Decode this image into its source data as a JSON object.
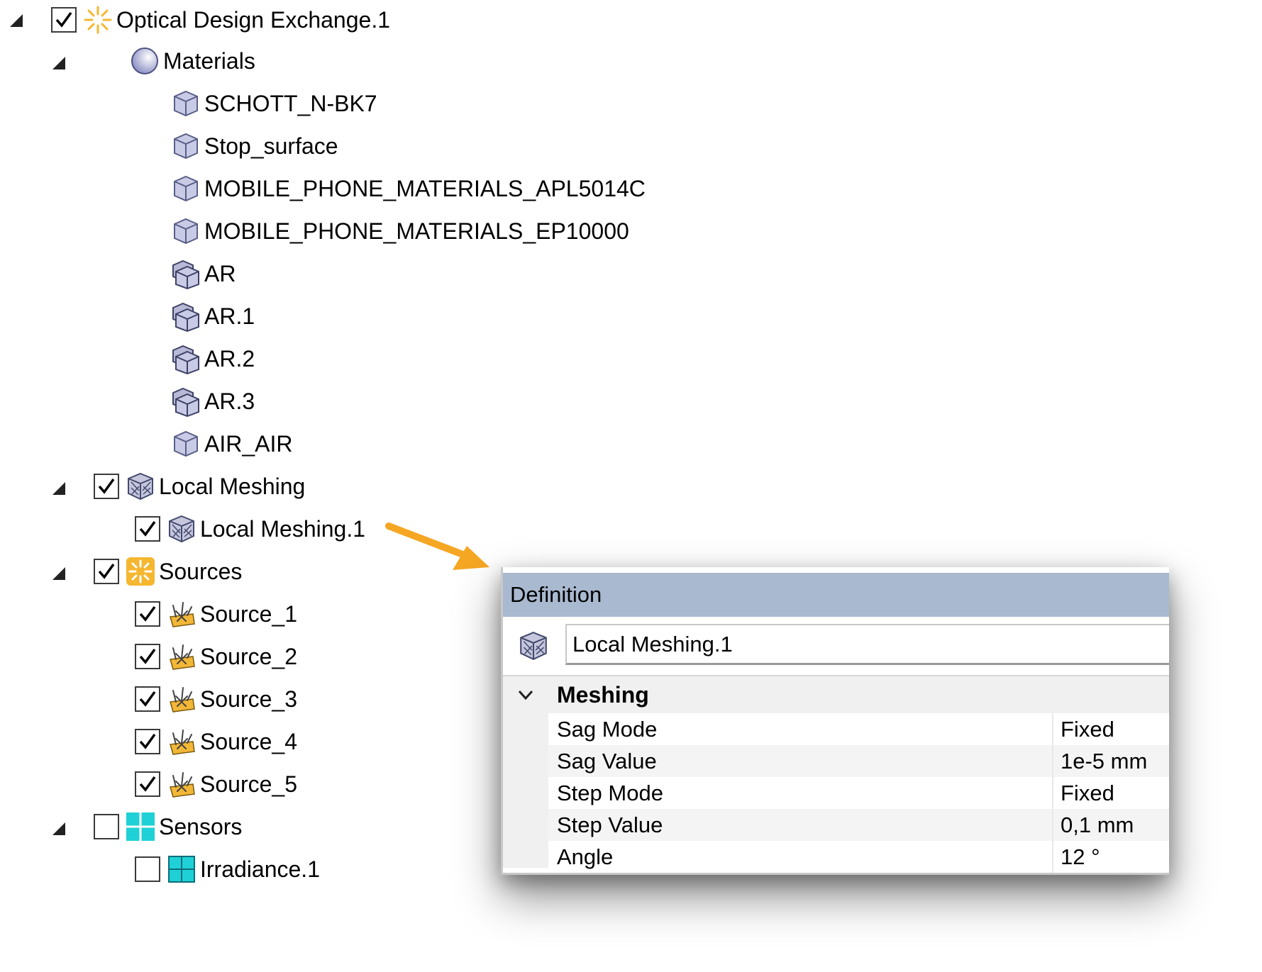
{
  "tree": {
    "root": {
      "label": "Optical Design Exchange.1",
      "checked": true,
      "icon": "sun-icon"
    },
    "materials": {
      "label": "Materials",
      "icon": "sphere-icon",
      "items": [
        {
          "label": "SCHOTT_N-BK7",
          "icon": "cube-icon"
        },
        {
          "label": "Stop_surface",
          "icon": "cube-icon"
        },
        {
          "label": "MOBILE_PHONE_MATERIALS_APL5014C",
          "icon": "cube-icon"
        },
        {
          "label": "MOBILE_PHONE_MATERIALS_EP10000",
          "icon": "cube-icon"
        },
        {
          "label": "AR",
          "icon": "stacked-cube-icon"
        },
        {
          "label": "AR.1",
          "icon": "stacked-cube-icon"
        },
        {
          "label": "AR.2",
          "icon": "stacked-cube-icon"
        },
        {
          "label": "AR.3",
          "icon": "stacked-cube-icon"
        },
        {
          "label": "AIR_AIR",
          "icon": "cube-icon"
        }
      ]
    },
    "local_meshing": {
      "label": "Local Meshing",
      "checked": true,
      "icon": "mesh-cube-icon",
      "items": [
        {
          "label": "Local Meshing.1",
          "checked": true,
          "icon": "mesh-cube-icon"
        }
      ]
    },
    "sources": {
      "label": "Sources",
      "checked": true,
      "icon": "source-group-icon",
      "items": [
        {
          "label": "Source_1",
          "checked": true,
          "icon": "source-icon"
        },
        {
          "label": "Source_2",
          "checked": true,
          "icon": "source-icon"
        },
        {
          "label": "Source_3",
          "checked": true,
          "icon": "source-icon"
        },
        {
          "label": "Source_4",
          "checked": true,
          "icon": "source-icon"
        },
        {
          "label": "Source_5",
          "checked": true,
          "icon": "source-icon"
        }
      ]
    },
    "sensors": {
      "label": "Sensors",
      "checked": false,
      "icon": "sensor-group-icon",
      "items": [
        {
          "label": "Irradiance.1",
          "checked": false,
          "icon": "irradiance-sensor-icon"
        }
      ]
    }
  },
  "definition": {
    "header": "Definition",
    "name_value": "Local Meshing.1",
    "category": "Meshing",
    "properties": [
      {
        "name": "Sag Mode",
        "value": "Fixed"
      },
      {
        "name": "Sag Value",
        "value": "1e-5 mm"
      },
      {
        "name": "Step Mode",
        "value": "Fixed"
      },
      {
        "name": "Step Value",
        "value": "0,1 mm"
      },
      {
        "name": "Angle",
        "value": "12 °"
      }
    ]
  },
  "colors": {
    "header_bg": "#a9b9d0",
    "arrow": "#f5a623",
    "cube": "#c9cbe6",
    "source": "#f2b736",
    "sensor": "#1fd1d6"
  }
}
